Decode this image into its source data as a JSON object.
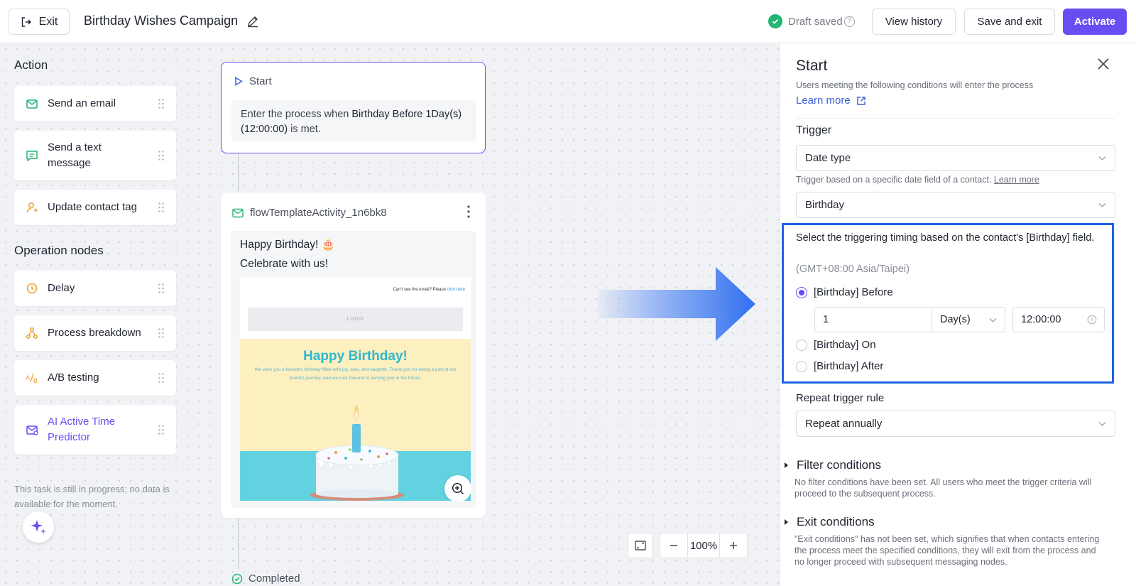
{
  "header": {
    "exit_label": "Exit",
    "campaign_title": "Birthday Wishes Campaign",
    "draft_status": "Draft saved",
    "view_history_label": "View history",
    "save_exit_label": "Save and exit",
    "activate_label": "Activate"
  },
  "palette": {
    "action_title": "Action",
    "action_items": [
      {
        "label": "Send an email",
        "icon": "mail-icon"
      },
      {
        "label": "Send a text message",
        "icon": "message-icon"
      },
      {
        "label": "Update contact tag",
        "icon": "user-tag-icon"
      }
    ],
    "operation_title": "Operation nodes",
    "operation_items": [
      {
        "label": "Delay",
        "icon": "clock-icon"
      },
      {
        "label": "Process breakdown",
        "icon": "branch-icon"
      },
      {
        "label": "A/B testing",
        "icon": "ab-test-icon"
      },
      {
        "label": "AI Active Time Predictor",
        "icon": "ai-predictor-icon"
      }
    ],
    "note": "This task is still in progress; no data is available for the moment."
  },
  "flow": {
    "start": {
      "title": "Start",
      "text_prefix": "Enter the process when",
      "condition": "Birthday Before 1Day(s) (12:00:00)",
      "text_suffix": "is met."
    },
    "email_node": {
      "name": "flowTemplateActivity_1n6bk8",
      "subject": "Happy Birthday! 🎂",
      "preheader": "Celebrate with us!",
      "preview": {
        "cant_see": "Can't see the email? Please",
        "click_here": "click here",
        "logo": "LOGO",
        "headline": "Happy Birthday!",
        "body": "We wish you a fantastic birthday filled with joy, love, and laughter. Thank you for being a part of our brand's journey, and we look forward to serving you in the future."
      }
    },
    "completed_label": "Completed",
    "zoom_level": "100%"
  },
  "panel": {
    "title": "Start",
    "subtitle": "Users meeting the following conditions will enter the process",
    "learn_more": "Learn more",
    "trigger_label": "Trigger",
    "trigger_type": "Date type",
    "trigger_hint": "Trigger based on a specific date field of a contact.",
    "trigger_hint_link": "Learn more",
    "date_field": "Birthday",
    "timing": {
      "instruction": "Select the triggering timing based on the contact's [Birthday] field.",
      "timezone": "(GMT+08:00 Asia/Taipei)",
      "options": [
        "[Birthday] Before",
        "[Birthday] On",
        "[Birthday] After"
      ],
      "selected": "[Birthday] Before",
      "offset_value": "1",
      "offset_unit": "Day(s)",
      "time": "12:00:00"
    },
    "repeat_label": "Repeat trigger rule",
    "repeat_value": "Repeat annually",
    "filter_title": "Filter conditions",
    "filter_desc": "No filter conditions have been set. All users who meet the trigger criteria will proceed to the subsequent process.",
    "exit_title": "Exit conditions",
    "exit_desc": "\"Exit conditions\" has not been set, which signifies that when contacts entering the process meet the specified conditions, they will exit from the process and no longer proceed with subsequent messaging nodes."
  },
  "colors": {
    "accent": "#6a4cf3",
    "highlight_border": "#1e63e3",
    "success": "#22b573",
    "link": "#3f5ed8"
  }
}
